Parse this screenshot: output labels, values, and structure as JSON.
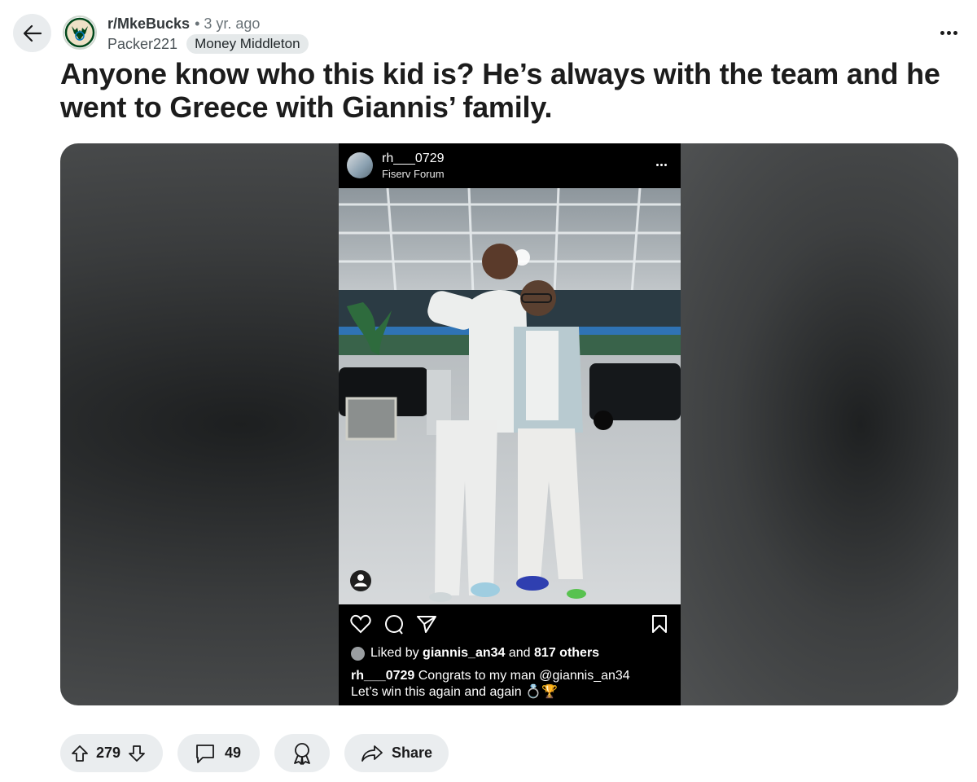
{
  "header": {
    "subreddit": "r/MkeBucks",
    "age": "3 yr. ago",
    "author": "Packer221",
    "flair": "Money Middleton"
  },
  "post": {
    "title": "Anyone know who this kid is? He’s always with the team and he went to Greece with Giannis’ family."
  },
  "embed": {
    "username": "rh___0729",
    "location": "Fiserv Forum",
    "liked_by_prefix": "Liked by",
    "liked_by_user": "giannis_an34",
    "liked_by_and": "and",
    "liked_by_others": "817 others",
    "caption_user": "rh___0729",
    "caption_text": "Congrats to my man @giannis_an34",
    "caption_line2": "Let’s win this again and again 💍🏆"
  },
  "actions": {
    "upvotes": "279",
    "comments": "49",
    "share_label": "Share"
  },
  "icons": {
    "back": "arrow-left-icon",
    "more": "more-horizontal-icon",
    "upvote": "upvote-icon",
    "downvote": "downvote-icon",
    "comment": "comment-icon",
    "award": "award-icon",
    "share": "share-icon"
  }
}
